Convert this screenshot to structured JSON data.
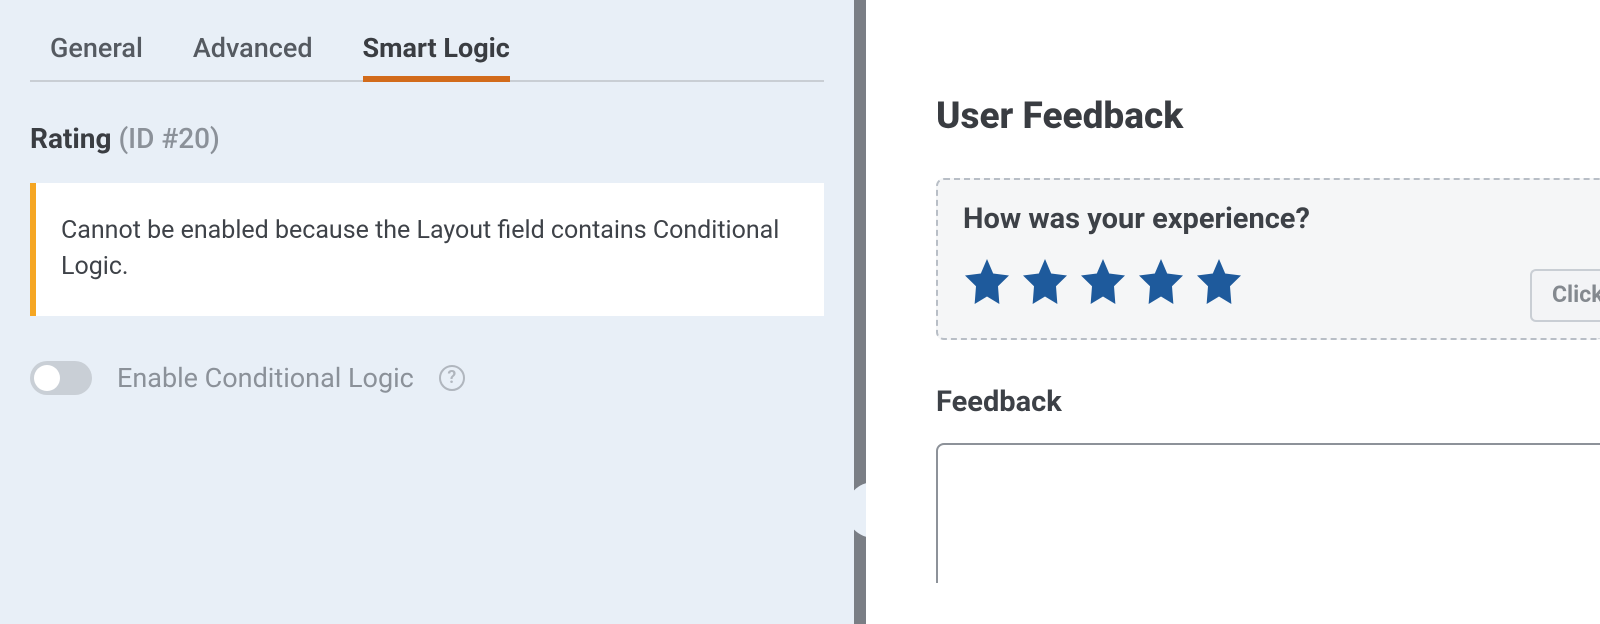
{
  "tabs": [
    {
      "label": "General"
    },
    {
      "label": "Advanced"
    },
    {
      "label": "Smart Logic"
    }
  ],
  "activeTab": 2,
  "field": {
    "name": "Rating",
    "idPrefix": "(ID #",
    "idNumber": "20",
    "idSuffix": ")"
  },
  "notice": {
    "text": "Cannot be enabled because the Layout field contains Conditional Logic."
  },
  "toggle": {
    "label": "Enable Conditional Logic",
    "enabled": false
  },
  "helpIcon": {
    "symbol": "?"
  },
  "collapse": {
    "chevron": "‹"
  },
  "preview": {
    "title": "User Feedback",
    "rating": {
      "label": "How was your experience?",
      "starCount": 5
    },
    "clickButton": {
      "label": "Click"
    },
    "feedback": {
      "label": "Feedback",
      "value": ""
    }
  },
  "colors": {
    "leftBg": "#e8eff7",
    "accent": "#d26b1b",
    "star": "#1e5a9c",
    "noticeBorder": "#f5a623"
  }
}
